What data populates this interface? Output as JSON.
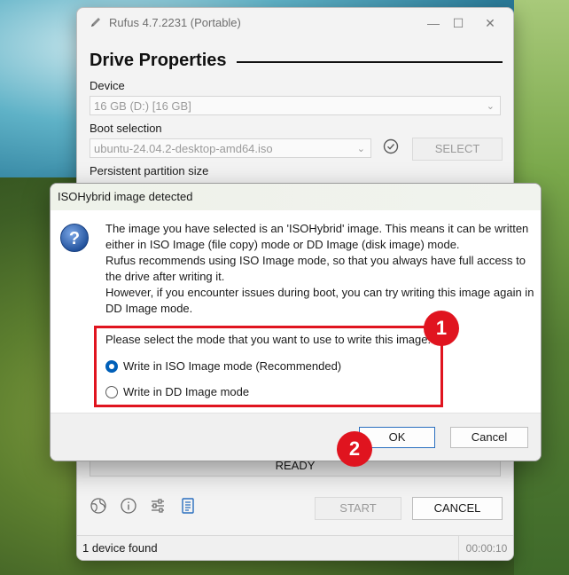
{
  "window": {
    "title": "Rufus 4.7.2231 (Portable)",
    "section_title": "Drive Properties",
    "device_label": "Device",
    "device_value": "16 GB (D:) [16 GB]",
    "boot_label": "Boot selection",
    "boot_value": "ubuntu-24.04.2-desktop-amd64.iso",
    "select_button": "SELECT",
    "persistent_label": "Persistent partition size",
    "progress_text": "READY",
    "start_button": "START",
    "cancel_button": "CANCEL",
    "status_text": "1 device found",
    "elapsed_time": "00:00:10"
  },
  "dialog": {
    "title": "ISOHybrid image detected",
    "message": [
      "The image you have selected is an 'ISOHybrid' image. This means it can be written either in ISO Image (file copy) mode or DD Image (disk image) mode.",
      "Rufus recommends using ISO Image mode, so that you always have full access to the drive after writing it.",
      "However, if you encounter issues during boot, you can try writing this image again in DD Image mode."
    ],
    "mode_prompt": "Please select the mode that you want to use to write this image:",
    "options": [
      {
        "label": "Write in ISO Image mode (Recommended)",
        "selected": true
      },
      {
        "label": "Write in DD Image mode",
        "selected": false
      }
    ],
    "ok_button": "OK",
    "cancel_button": "Cancel"
  },
  "annotations": {
    "badge_1": "1",
    "badge_2": "2",
    "color": "#e0141f"
  },
  "icons": [
    "pen-icon",
    "minimize-icon",
    "maximize-icon",
    "close-icon",
    "check-circle-icon",
    "globe-icon",
    "info-icon",
    "settings-sliders-icon",
    "log-icon",
    "question-icon"
  ]
}
